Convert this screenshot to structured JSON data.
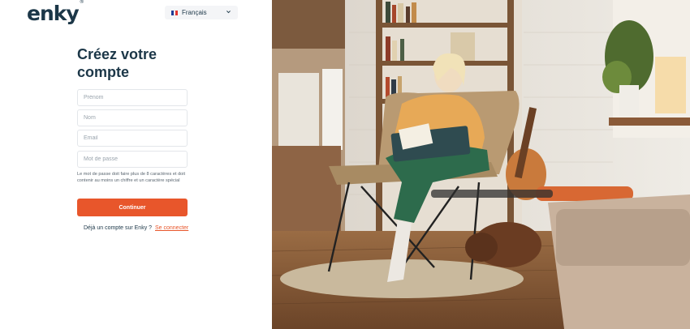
{
  "brand": {
    "name": "enky",
    "mark": "®"
  },
  "language": {
    "selected": "Français",
    "flag_colors": [
      "#1f3c94",
      "#ffffff",
      "#e3342f"
    ]
  },
  "form": {
    "title": "Créez votre compte",
    "fields": {
      "first_name_placeholder": "Prénom",
      "last_name_placeholder": "Nom",
      "email_placeholder": "Email",
      "password_placeholder": "Mot de passe"
    },
    "password_hint": "Le mot de passe doit faire plus de 8 caractères et doit contenir au moins un chiffre et un caractère spécial",
    "submit_label": "Continuer",
    "login_prompt": "Déjà un compte sur Enky ?",
    "login_link": "Se connecter"
  },
  "colors": {
    "accent": "#e8562b",
    "text": "#1c3748"
  }
}
